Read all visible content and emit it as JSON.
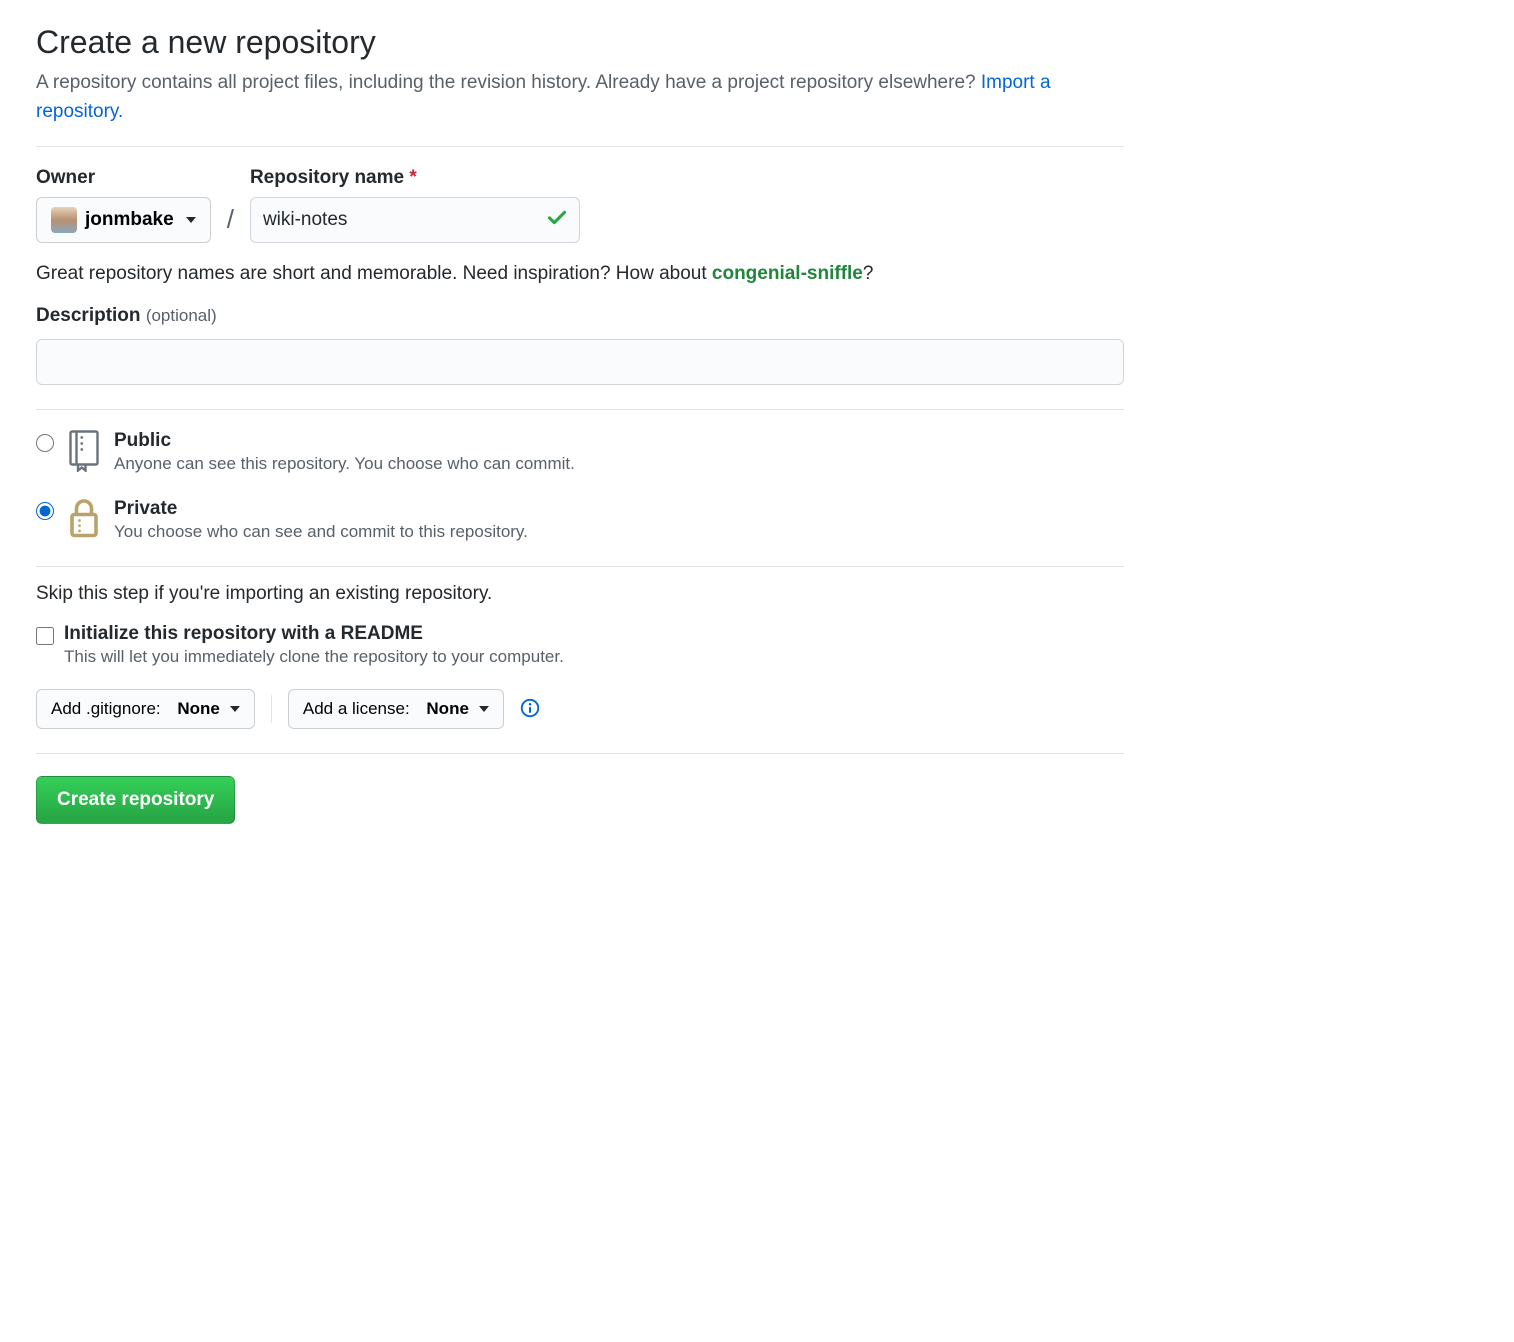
{
  "header": {
    "title": "Create a new repository",
    "subtitle_prefix": "A repository contains all project files, including the revision history. Already have a project repository elsewhere? ",
    "import_link": "Import a repository."
  },
  "owner": {
    "label": "Owner",
    "username": "jonmbake"
  },
  "repo": {
    "label": "Repository name",
    "required_mark": "*",
    "value": "wiki-notes"
  },
  "name_hint": {
    "prefix": "Great repository names are short and memorable. Need inspiration? How about ",
    "suggestion": "congenial-sniffle",
    "suffix": "?"
  },
  "description": {
    "label": "Description",
    "optional": "(optional)",
    "value": ""
  },
  "visibility": {
    "public": {
      "title": "Public",
      "desc": "Anyone can see this repository. You choose who can commit."
    },
    "private": {
      "title": "Private",
      "desc": "You choose who can see and commit to this repository."
    },
    "selected": "private"
  },
  "init": {
    "skip_text": "Skip this step if you're importing an existing repository.",
    "readme_title": "Initialize this repository with a README",
    "readme_desc": "This will let you immediately clone the repository to your computer."
  },
  "gitignore": {
    "label": "Add .gitignore:",
    "value": "None"
  },
  "license": {
    "label": "Add a license:",
    "value": "None"
  },
  "submit": {
    "label": "Create repository"
  }
}
